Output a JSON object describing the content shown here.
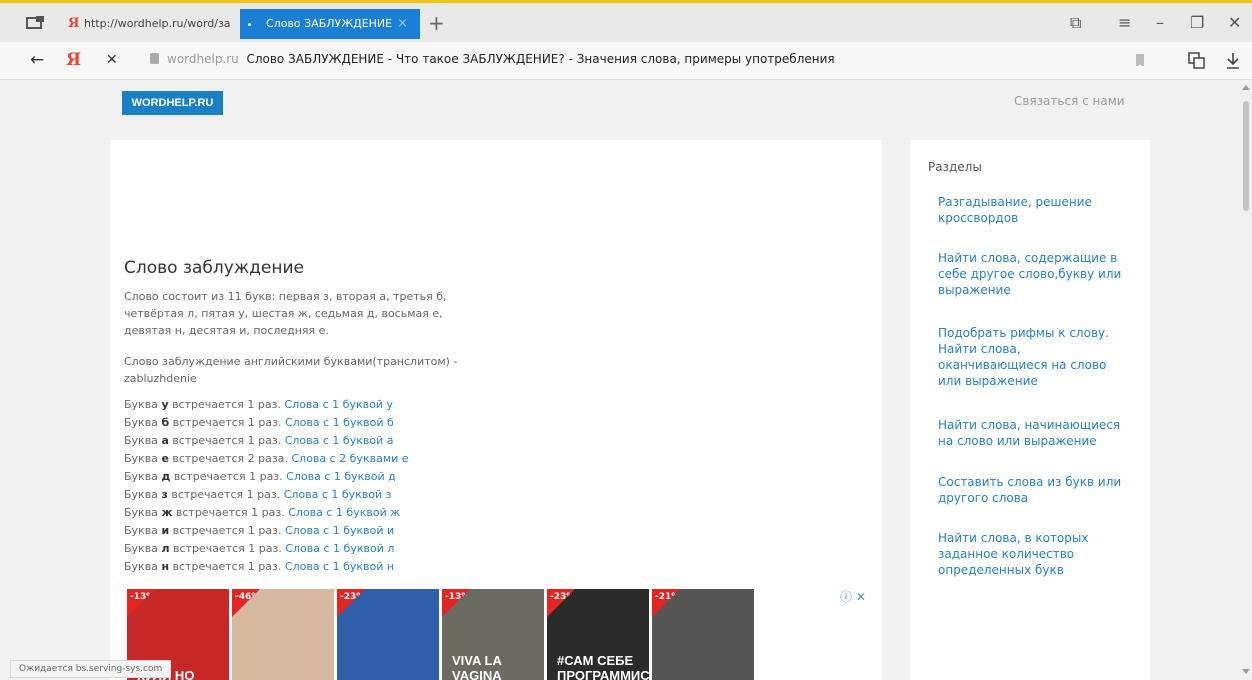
{
  "browser": {
    "tabs": [
      {
        "label": "http://wordhelp.ru/word/за",
        "favicon": "yandex-icon"
      },
      {
        "label": "Слово ЗАБЛУЖДЕНИЕ",
        "close": "×"
      }
    ],
    "new_tab": "+",
    "address": {
      "host": "wordhelp.ru",
      "title": "Слово ЗАБЛУЖДЕНИЕ - Что такое ЗАБЛУЖДЕНИЕ? - Значения слова, примеры употребления"
    },
    "window_buttons": [
      "⧉",
      "≡",
      "–",
      "❐",
      "✕"
    ],
    "nav": {
      "back": "←",
      "yandex": "Я",
      "stop": "✕"
    }
  },
  "site": {
    "logo": "WORDHELP.RU",
    "contact": "Связаться с нами"
  },
  "article": {
    "title": "Слово заблуждение",
    "description": "Слово состоит из 11 букв: первая з, вторая а, третья б, четвёртая л, пятая у, шестая ж, седьмая д, восьмая е, девятая н, десятая и, последняя е.",
    "translit": "Слово заблуждение английскими буквами(транслитом) - zabluzhdenie",
    "letters": [
      {
        "prefix": "Буква",
        "letter": "у",
        "count": "встречается 1 раз.",
        "link": "Слова с 1 буквой у"
      },
      {
        "prefix": "Буква",
        "letter": "б",
        "count": "встречается 1 раз.",
        "link": "Слова с 1 буквой б"
      },
      {
        "prefix": "Буква",
        "letter": "а",
        "count": "встречается 1 раз.",
        "link": "Слова с 1 буквой а"
      },
      {
        "prefix": "Буква",
        "letter": "е",
        "count": "встречается 2 раза.",
        "link": "Слова с 2 буквами е"
      },
      {
        "prefix": "Буква",
        "letter": "д",
        "count": "встречается 1 раз.",
        "link": "Слова с 1 буквой д"
      },
      {
        "prefix": "Буква",
        "letter": "з",
        "count": "встречается 1 раз.",
        "link": "Слова с 1 буквой з"
      },
      {
        "prefix": "Буква",
        "letter": "ж",
        "count": "встречается 1 раз.",
        "link": "Слова с 1 буквой ж"
      },
      {
        "prefix": "Буква",
        "letter": "и",
        "count": "встречается 1 раз.",
        "link": "Слова с 1 буквой и"
      },
      {
        "prefix": "Буква",
        "letter": "л",
        "count": "встречается 1 раз.",
        "link": "Слова с 1 буквой л"
      },
      {
        "prefix": "Буква",
        "letter": "н",
        "count": "встречается 1 раз.",
        "link": "Слова с 1 буквой н"
      }
    ]
  },
  "ads": {
    "info": "ⓘ ✕",
    "books": [
      {
        "discount": "-13%",
        "text": "КУЛИ НО",
        "color": "#c62828"
      },
      {
        "discount": "-46%",
        "text": "",
        "color": "#d7b9a2"
      },
      {
        "discount": "-23%",
        "text": "",
        "color": "#2f5fa8"
      },
      {
        "discount": "-13%",
        "text": "VIVA LA VAGINA",
        "color": "#6b6a63"
      },
      {
        "discount": "-23%",
        "text": "#САМ СЕБЕ ПРОГРАММИСТ",
        "color": "#2b2b2b"
      },
      {
        "discount": "-21%",
        "text": "",
        "color": "#555"
      }
    ]
  },
  "sidebar": {
    "title": "Разделы",
    "links": [
      "Разгадывание, решение кроссвордов",
      "Найти слова, содержащие в себе другое слово,букву или выражение",
      "Подобрать рифмы к слову. Найти слова, оканчивающиеся на слово или выражение",
      "Найти слова, начинающиеся на слово или выражение",
      "Составить слова из букв или другого слова",
      "Найти слова, в которых заданное количество определенных букв"
    ]
  },
  "status": "Ожидается bs.serving-sys.com"
}
